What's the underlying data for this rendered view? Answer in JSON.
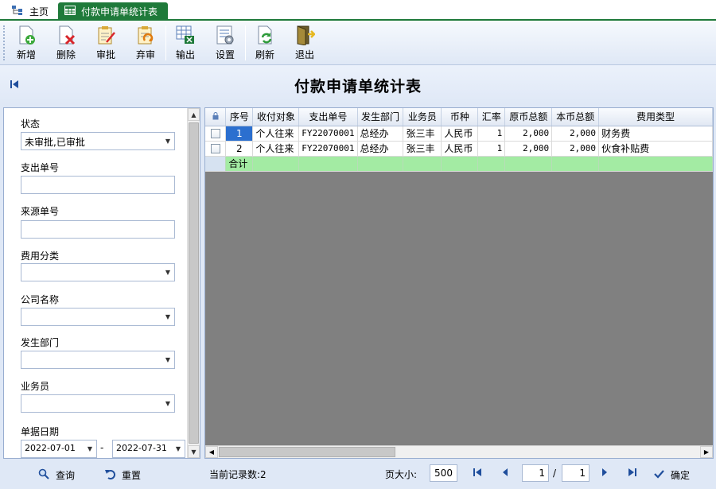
{
  "tabs": [
    {
      "label": "主页",
      "icon": "home-tree-icon"
    },
    {
      "label": "付款申请单统计表",
      "icon": "table-icon"
    }
  ],
  "toolbar": {
    "add": "新增",
    "delete": "删除",
    "approve": "审批",
    "unapprove": "弃审",
    "export": "输出",
    "settings": "设置",
    "refresh": "刷新",
    "exit": "退出"
  },
  "page_title": "付款申请单统计表",
  "filters": {
    "status_label": "状态",
    "status_value": "未审批,已审批",
    "expense_no_label": "支出单号",
    "expense_no_value": "",
    "source_no_label": "来源单号",
    "source_no_value": "",
    "expense_category_label": "费用分类",
    "expense_category_value": "",
    "company_label": "公司名称",
    "company_value": "",
    "department_label": "发生部门",
    "department_value": "",
    "salesperson_label": "业务员",
    "salesperson_value": "",
    "date_label": "单据日期",
    "date_from": "2022-07-01",
    "date_sep": "-",
    "date_to": "2022-07-31"
  },
  "grid": {
    "columns": [
      "序号",
      "收付对象",
      "支出单号",
      "发生部门",
      "业务员",
      "币种",
      "汇率",
      "原币总额",
      "本币总额",
      "费用类型"
    ],
    "rows": [
      {
        "seq": "1",
        "payee": "个人往来",
        "expense_no": "FY22070001",
        "department": "总经办",
        "salesperson": "张三丰",
        "currency": "人民币",
        "rate": "1",
        "orig_amount": "2,000",
        "local_amount": "2,000",
        "expense_type": "财务费"
      },
      {
        "seq": "2",
        "payee": "个人往来",
        "expense_no": "FY22070001",
        "department": "总经办",
        "salesperson": "张三丰",
        "currency": "人民币",
        "rate": "1",
        "orig_amount": "2,000",
        "local_amount": "2,000",
        "expense_type": "伙食补贴费"
      }
    ],
    "summary_label": "合计"
  },
  "footer": {
    "query": "查询",
    "reset": "重置",
    "record_count": "当前记录数:2",
    "page_size_label": "页大小:",
    "page_size": "500",
    "current_page": "1",
    "page_sep": "/",
    "total_pages": "1",
    "confirm": "确定"
  }
}
